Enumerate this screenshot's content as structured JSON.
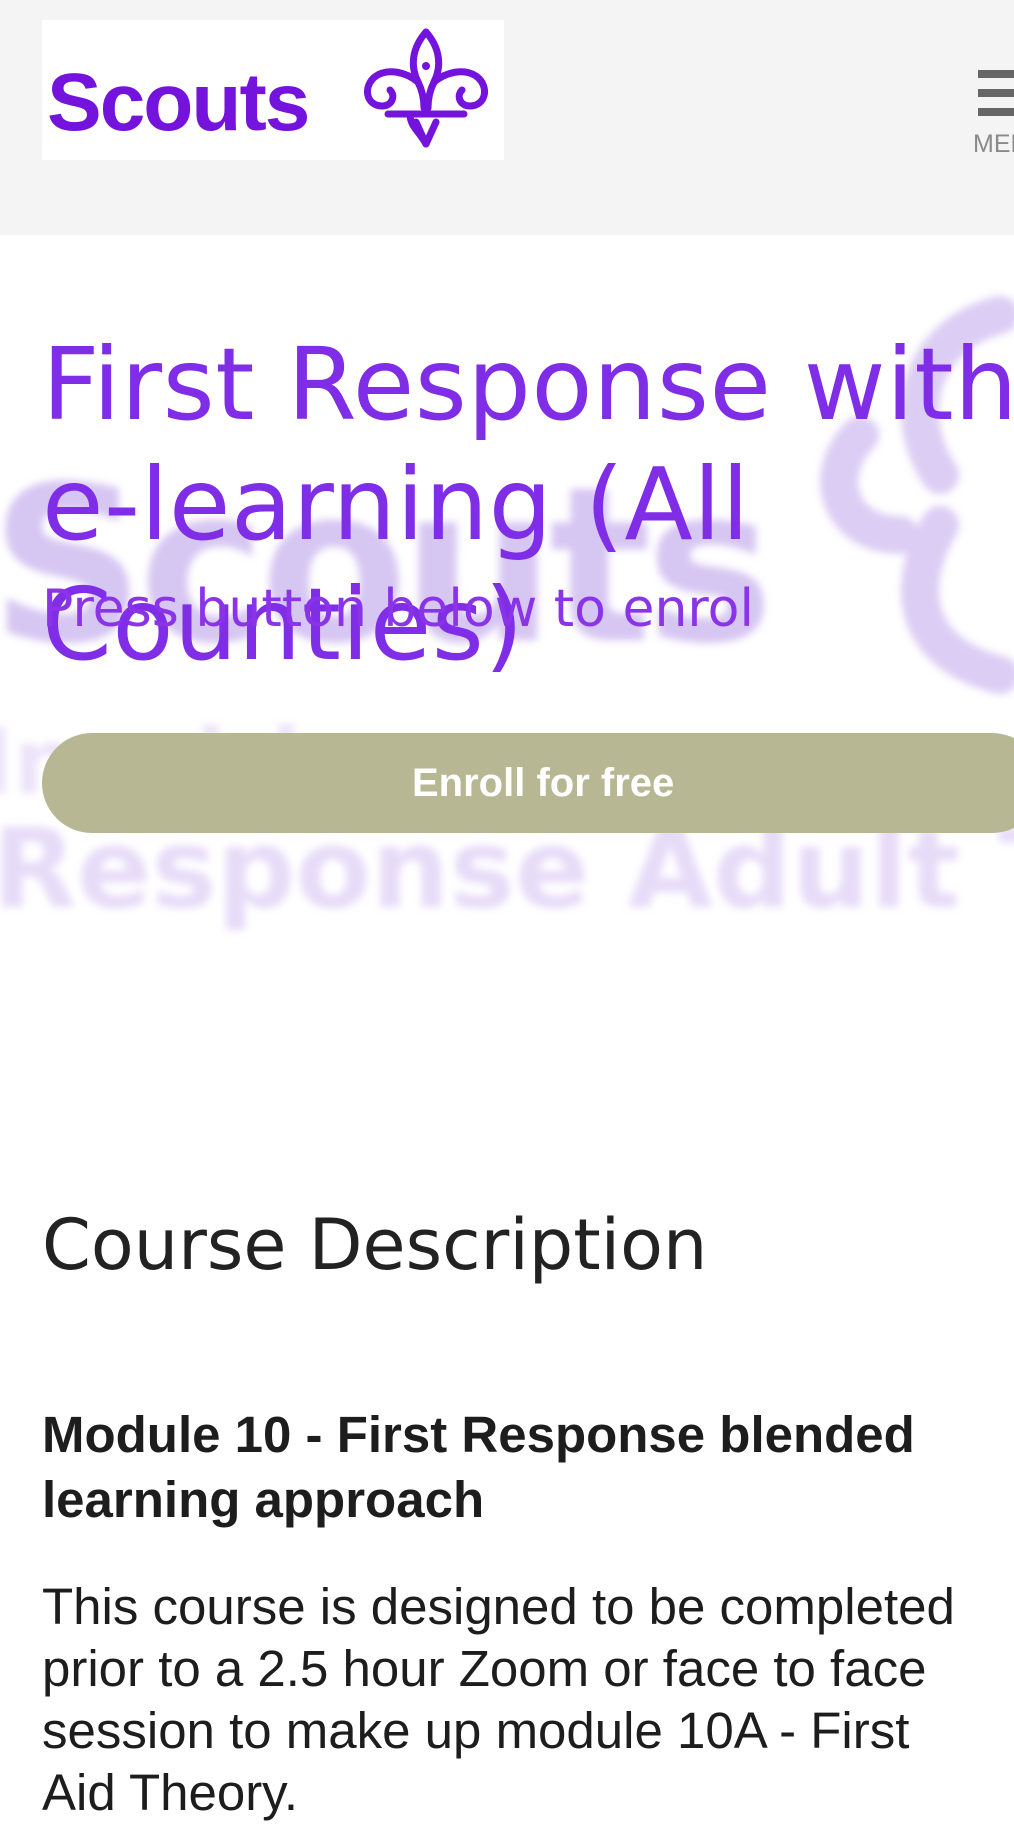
{
  "header": {
    "logo_text": "Scouts",
    "menu_label": "MENU"
  },
  "course": {
    "title": "First Response with e-learning (All Counties)",
    "subtitle": "Press button below to enrol",
    "enroll_label": "Enroll for free"
  },
  "background_image": {
    "line1": "Scouts",
    "line2": "Inspiring",
    "line3": "Response Adult Training"
  },
  "description": {
    "heading": "Course Description",
    "module_title": "Module 10 - First Response blended learning approach",
    "body_lines": [
      "This course is designed to be completed",
      "prior to a 2.5 hour Zoom or face to face",
      "session to make up module 10A - First",
      "Aid Theory."
    ]
  },
  "colors": {
    "brand_purple": "#7413dc",
    "title_purple": "#7f2de6",
    "button_khaki": "#b8b793",
    "header_bg": "#f4f4f4"
  },
  "icons": {
    "logo_mark": "fleur-de-lis-icon",
    "menu": "hamburger-menu-icon"
  }
}
